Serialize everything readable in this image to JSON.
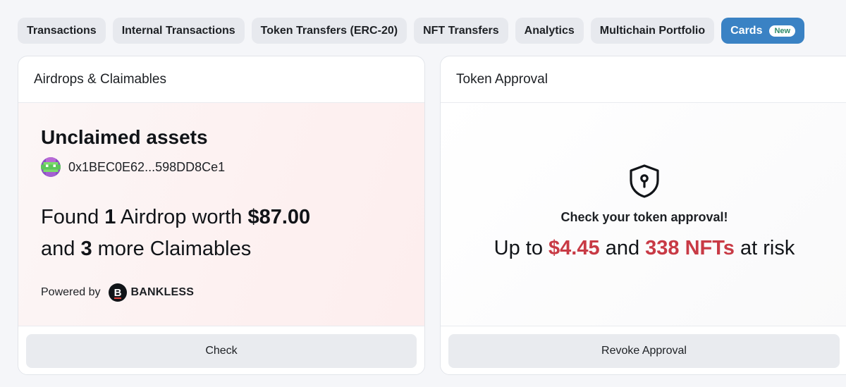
{
  "tabs": [
    {
      "label": "Transactions",
      "active": false
    },
    {
      "label": "Internal Transactions",
      "active": false
    },
    {
      "label": "Token Transfers (ERC-20)",
      "active": false
    },
    {
      "label": "NFT Transfers",
      "active": false
    },
    {
      "label": "Analytics",
      "active": false
    },
    {
      "label": "Multichain Portfolio",
      "active": false
    },
    {
      "label": "Cards",
      "active": true,
      "badge": "New"
    }
  ],
  "airdrops_card": {
    "title": "Airdrops & Claimables",
    "heading": "Unclaimed assets",
    "address": "0x1BEC0E62...598DD8Ce1",
    "found_prefix": "Found",
    "airdrop_count": "1",
    "airdrop_label": "Airdrop worth",
    "airdrop_value": "$87.00",
    "and_text": "and",
    "claimable_count": "3",
    "claimable_label": "more Claimables",
    "powered_by": "Powered by",
    "partner_name": "BANKLESS",
    "partner_initial": "B",
    "button_label": "Check"
  },
  "approval_card": {
    "title": "Token Approval",
    "prompt": "Check your token approval!",
    "risk_prefix": "Up to",
    "risk_value": "$4.45",
    "risk_and": "and",
    "risk_nfts": "338 NFTs",
    "risk_suffix": "at risk",
    "button_label": "Revoke Approval"
  },
  "colors": {
    "accent": "#3a82c4",
    "badge_text": "#2d8a68",
    "risk": "#c83a45"
  },
  "icons": {
    "shield": "shield-keyhole-icon",
    "avatar": "pixel-avatar-icon",
    "partner": "bankless-logo-icon"
  }
}
